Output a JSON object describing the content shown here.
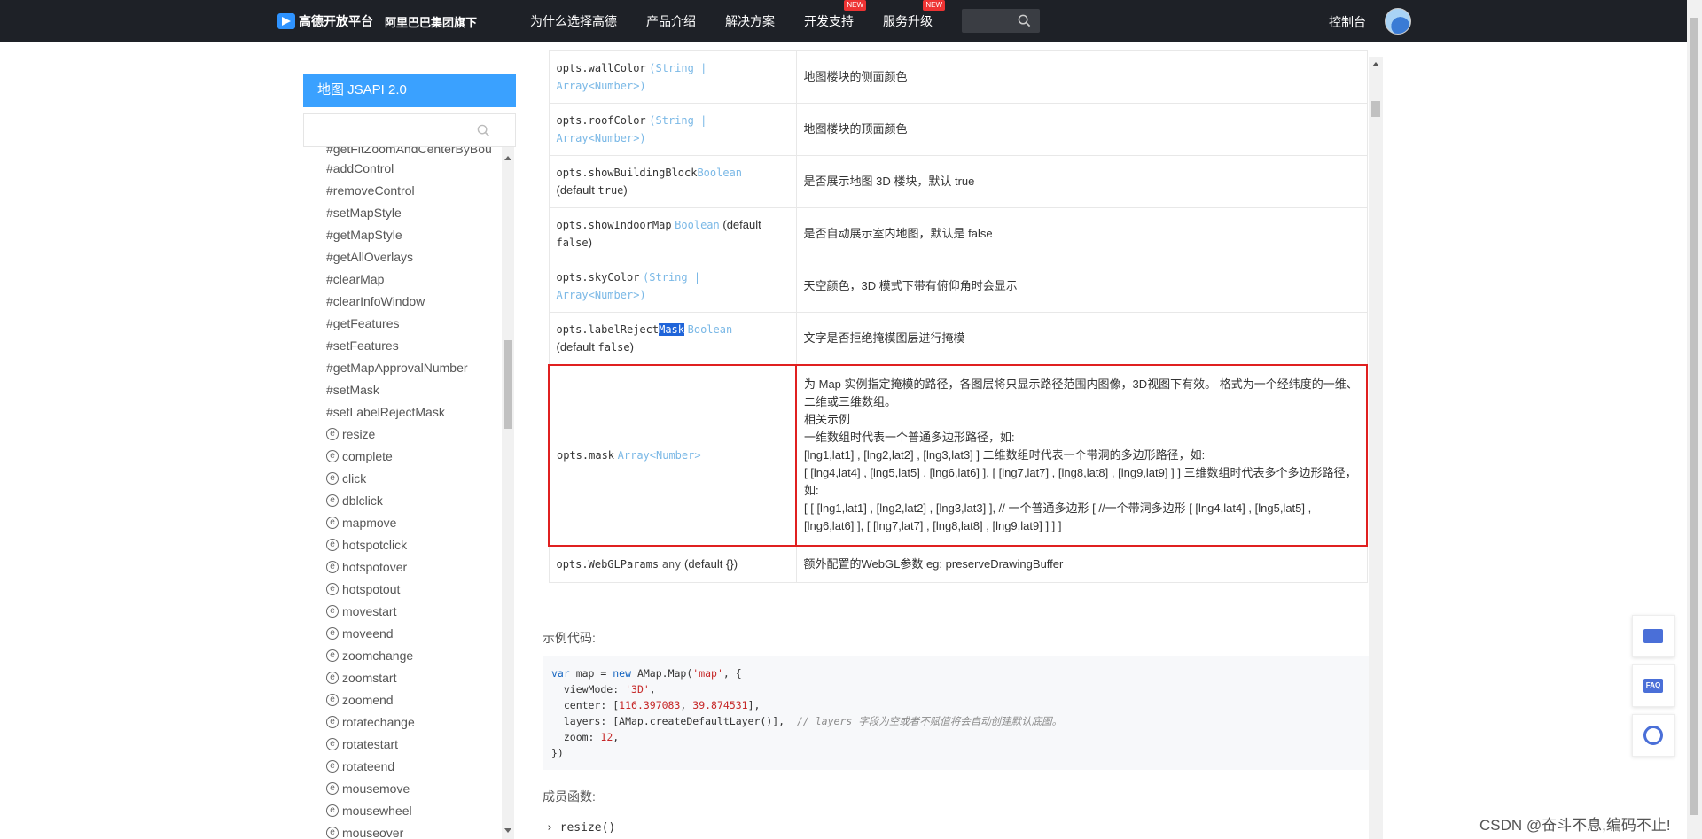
{
  "header": {
    "logo_text": "高德开放平台",
    "logo_sub": "阿里巴巴集团旗下",
    "nav": [
      {
        "label": "为什么选择高德",
        "badge": ""
      },
      {
        "label": "产品介绍",
        "badge": ""
      },
      {
        "label": "解决方案",
        "badge": ""
      },
      {
        "label": "开发支持",
        "badge": "NEW"
      },
      {
        "label": "服务升级",
        "badge": "NEW"
      }
    ],
    "console": "控制台"
  },
  "sidebar": {
    "title": "地图 JSAPI 2.0",
    "cut_item": "#getFitZoomAndCenterByBou",
    "methods": [
      "#addControl",
      "#removeControl",
      "#setMapStyle",
      "#getMapStyle",
      "#getAllOverlays",
      "#clearMap",
      "#clearInfoWindow",
      "#getFeatures",
      "#setFeatures",
      "#getMapApprovalNumber",
      "#setMask",
      "#setLabelRejectMask"
    ],
    "event_icon": "e",
    "events": [
      "resize",
      "complete",
      "click",
      "dblclick",
      "mapmove",
      "hotspotclick",
      "hotspotover",
      "hotspotout",
      "movestart",
      "moveend",
      "zoomchange",
      "zoomstart",
      "zoomend",
      "rotatechange",
      "rotatestart",
      "rotateend",
      "mousemove",
      "mousewheel",
      "mouseover"
    ]
  },
  "table": {
    "rows": [
      {
        "name": "opts.wallColor",
        "type_a": "(String |",
        "type_b": "Array<Number>)",
        "desc": "地图楼块的侧面颜色"
      },
      {
        "name": "opts.roofColor",
        "type_a": "(String |",
        "type_b": "Array<Number>)",
        "desc": "地图楼块的顶面颜色"
      },
      {
        "name": "opts.showBuildingBlock",
        "type_a": "Boolean",
        "default_pre": "(default",
        "default_val": "true",
        "default_post": ")",
        "desc": "是否展示地图 3D 楼块，默认 true"
      },
      {
        "name": "opts.showIndoorMap",
        "type_a": "Boolean",
        "default_pre": "(default",
        "default_val": "false",
        "default_post": ")",
        "desc": "是否自动展示室内地图，默认是 false"
      },
      {
        "name": "opts.skyColor",
        "type_a": "(String |",
        "type_b": "Array<Number>)",
        "desc": "天空颜色，3D 模式下带有俯仰角时会显示"
      },
      {
        "name_pre": "opts.labelReject",
        "name_hl": "Mask",
        "type_a": "Boolean",
        "default_pre": "(default",
        "default_val": "false",
        "default_post": ")",
        "desc": "文字是否拒绝掩模图层进行掩模"
      }
    ],
    "mask_row": {
      "name": "opts.mask",
      "type": "Array<Number>",
      "desc": [
        "为 Map 实例指定掩模的路径，各图层将只显示路径范围内图像，3D视图下有效。 格式为一个经纬度的一维、二维或三维数组。",
        "相关示例",
        "一维数组时代表一个普通多边形路径，如:",
        "[lng1,lat1] , [lng2,lat2] , [lng3,lat3] ] 二维数组时代表一个带洞的多边形路径，如:",
        "[ [lng4,lat4] , [lng5,lat5] , [lng6,lat6] ], [ [lng7,lat7] , [lng8,lat8] , [lng9,lat9] ] ] 三维数组时代表多个多边形路径，如:",
        "[ [ [lng1,lat1] , [lng2,lat2] , [lng3,lat3] ], // 一个普通多边形 [ //一个带洞多边形 [ [lng4,lat4] , [lng5,lat5] , [lng6,lat6] ], [ [lng7,lat7] , [lng8,lat8] , [lng9,lat9] ] ] ]"
      ]
    },
    "webgl_row": {
      "name": "opts.WebGLParams",
      "type": "any",
      "default": "(default {})",
      "desc": "额外配置的WebGL参数 eg: preserveDrawingBuffer"
    }
  },
  "example": {
    "label": "示例代码:",
    "code": {
      "l1_a": "var",
      "l1_b": " map = ",
      "l1_c": "new",
      "l1_d": " AMap.Map(",
      "l1_e": "'map'",
      "l1_f": ", {",
      "l2_a": "  viewMode: ",
      "l2_b": "'3D'",
      "l2_c": ",",
      "l3_a": "  center: [",
      "l3_b": "116.397083",
      "l3_c": ", ",
      "l3_d": "39.874531",
      "l3_e": "],",
      "l4_a": "  layers: [AMap.createDefaultLayer()],  ",
      "l4_b": "// layers 字段为空或者不赋值将会自动创建默认底图。",
      "l5_a": "  zoom: ",
      "l5_b": "12",
      "l5_c": ",",
      "l6": "})"
    }
  },
  "members": {
    "label": "成员函数:",
    "first": "› resize()"
  },
  "float_buttons": {
    "faq": "FAQ"
  },
  "watermark": "CSDN @奋斗不息,编码不止!"
}
